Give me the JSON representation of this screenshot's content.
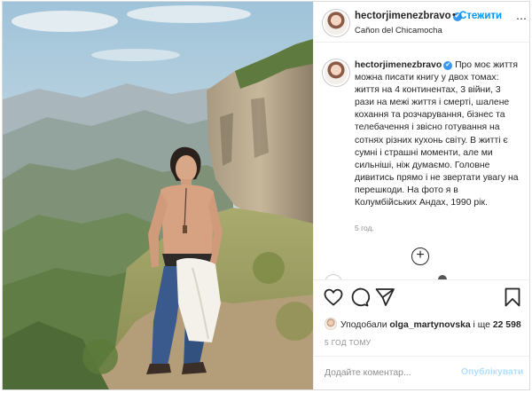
{
  "header": {
    "username": "hectorjimenezbravo",
    "verified_badge": "✔",
    "separator": "•",
    "follow_label": "Стежити",
    "location": "Cañon del Chicamocha",
    "more_icon": "⋯"
  },
  "caption": {
    "username": "hectorjimenezbravo",
    "text": "Про моє життя можна писати книгу у двох томах: життя на 4 континентах, 3 війни, 3 рази на межі життя і смерті, шалене кохання та розчарування, бізнес та телебачення і звісно готування на сотнях різних кухонь світу. В житті є сумні і страшні моменти, але ми сильніші, ніж думаємо. Головне дивитись прямо і не звертати увагу на перешкоди. На фото я в Колумбійських Андах, 1990 рік.",
    "age": "5 год.",
    "load_more_icon": "+"
  },
  "actions": {
    "like_icon": "heart-icon",
    "comment_icon": "comment-icon",
    "share_icon": "send-icon",
    "save_icon": "bookmark-icon"
  },
  "likes": {
    "prefix": "Уподобали",
    "first_user": "olga_martynovska",
    "middle": "і ще",
    "count": "22 598"
  },
  "timestamp": "5 ГОД ТОМУ",
  "comment": {
    "placeholder": "Додайте коментар...",
    "publish_label": "Опублікувати"
  },
  "colors": {
    "accent": "#0095f6",
    "verified": "#3897f0",
    "publish_disabled": "#b2dffc",
    "muted": "#8e8e8e",
    "border": "#dbdbdb"
  }
}
